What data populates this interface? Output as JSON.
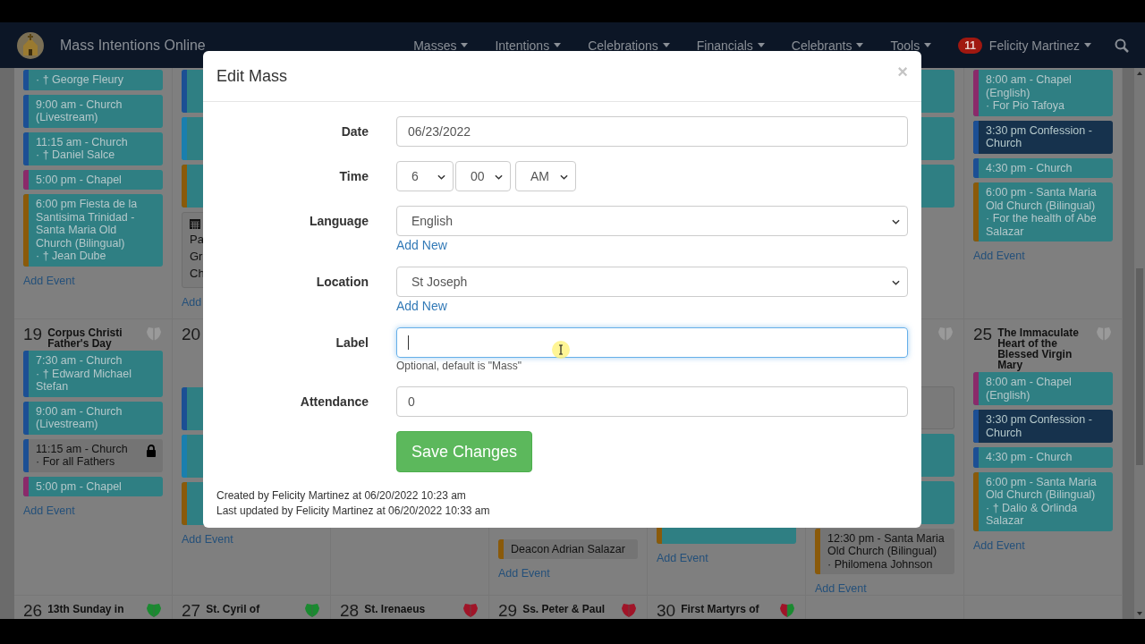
{
  "navbar": {
    "brand": "Mass Intentions Online",
    "menus": [
      "Masses",
      "Intentions",
      "Celebrations",
      "Financials",
      "Celebrants",
      "Tools"
    ],
    "notifications": "11",
    "user": "Felicity Martinez"
  },
  "calendar": {
    "columns": [
      {
        "top": {
          "events": [
            {
              "kind": "mass",
              "color": "#1c4f94",
              "intention": "· † George Fleury"
            },
            {
              "kind": "mass",
              "color": "#1c4f94",
              "title": "9:00 am - Church (Livestream)"
            },
            {
              "kind": "mass",
              "color": "#1c4f94",
              "title": "11:15 am - Church",
              "intention": "· † Daniel Salce"
            },
            {
              "kind": "mass",
              "color": "#8a2a6a",
              "title": "5:00 pm - Chapel"
            },
            {
              "kind": "mass",
              "color": "#8a5a0a",
              "title": "6:00 pm Fiesta de la Santisima Trinidad - Santa Maria Old Church (Bilingual)",
              "intention": "· † Jean Dube"
            }
          ],
          "add_event": "Add Event"
        },
        "middle": {
          "day": "19",
          "titles": [
            "Corpus Christi",
            "Father's Day"
          ],
          "vestment": [
            {
              "color": "#9a9a9a"
            }
          ],
          "events": [
            {
              "kind": "mass",
              "color": "#1c4f94",
              "title": "7:30 am - Church",
              "intention": "· † Edward Michael Stefan"
            },
            {
              "kind": "mass",
              "color": "#1c4f94",
              "title": "9:00 am - Church (Livestream)"
            },
            {
              "kind": "plain",
              "color": "#1c4f94",
              "locked": true,
              "title": "11:15 am - Church",
              "intention": "· For all Fathers"
            },
            {
              "kind": "mass",
              "color": "#8a2a6a",
              "title": "5:00 pm - Chapel"
            }
          ],
          "add_event": "Add Event"
        },
        "bottom": {
          "day": "26",
          "titles": [
            "13th Sunday in"
          ],
          "vestment": [
            {
              "color": "#1a8a30"
            }
          ]
        }
      },
      {
        "top": {
          "events": [
            {
              "kind": "mass",
              "color": "#1c4f94"
            },
            {
              "kind": "mass",
              "color": "#1a7fae"
            },
            {
              "kind": "mass",
              "color": "#8a5a0a"
            },
            {
              "kind": "note",
              "lines": [
                "Pa",
                "Gr",
                "Ch"
              ]
            }
          ],
          "add_event": "Add"
        },
        "middle": {
          "day": "20",
          "events": [
            {
              "kind": "mass",
              "color": "#1c4f94"
            },
            {
              "kind": "mass",
              "color": "#1a7fae"
            },
            {
              "kind": "mass",
              "color": "#8a5a0a"
            }
          ],
          "add_event": "Add Event"
        },
        "bottom": {
          "day": "27",
          "titles": [
            "St. Cyril of"
          ],
          "vestment": [
            {
              "color": "#1a8a30"
            }
          ]
        }
      },
      {
        "bottom": {
          "day": "28",
          "titles": [
            "St. Irenaeus"
          ],
          "vestment": [
            {
              "color": "#a01428"
            }
          ]
        }
      },
      {
        "middle": {
          "events": [
            {
              "kind": "plain",
              "color": "#8a5a0a",
              "locked": false,
              "intention": "Deacon Adrian Salazar"
            }
          ],
          "add_event": "Add Event"
        },
        "bottom": {
          "day": "29",
          "titles": [
            "Ss. Peter & Paul"
          ],
          "vestment": [
            {
              "color": "#a01428"
            }
          ]
        }
      },
      {
        "middle": {
          "events": [
            {
              "kind": "mass",
              "color": "#8a5a0a"
            }
          ],
          "add_event": "Add Event"
        },
        "bottom": {
          "day": "30",
          "titles": [
            "First Martyrs of"
          ],
          "vestment": [
            {
              "color": "#a01428"
            },
            {
              "color": "#1a8a30"
            }
          ]
        }
      },
      {
        "top": {
          "events": [
            {
              "kind": "mass"
            },
            {
              "kind": "mass"
            },
            {
              "kind": "mass"
            }
          ]
        },
        "middle": {
          "vestment": [
            {
              "color": "#9a9a9a"
            }
          ],
          "events": [
            {
              "kind": "note"
            },
            {
              "kind": "mass"
            },
            {
              "kind": "mass"
            },
            {
              "kind": "plain",
              "color": "#8a5a0a",
              "locked": false,
              "title": "12:30 pm - Santa Maria Old Church (Bilingual)",
              "intention": "· Philomena Johnson"
            }
          ],
          "add_event": "Add Event"
        }
      },
      {
        "top": {
          "events": [
            {
              "kind": "mass",
              "color": "#8a2a6a",
              "title": "8:00 am - Chapel (English)",
              "intention": "· For Pio Tafoya"
            },
            {
              "kind": "confession",
              "color": "#1c4f94",
              "title": "3:30 pm Confession - Church"
            },
            {
              "kind": "mass",
              "color": "#1c4f94",
              "title": "4:30 pm - Church"
            },
            {
              "kind": "mass",
              "color": "#8a5a0a",
              "title": "6:00 pm - Santa Maria Old Church (Bilingual)",
              "intention": "· For the health of Abe Salazar"
            }
          ],
          "add_event": "Add Event"
        },
        "middle": {
          "day": "25",
          "titles": [
            "The Immaculate Heart of the Blessed Virgin Mary"
          ],
          "vestment": [
            {
              "color": "#9a9a9a"
            }
          ],
          "events": [
            {
              "kind": "mass",
              "color": "#8a2a6a",
              "title": "8:00 am - Chapel (English)"
            },
            {
              "kind": "confession",
              "color": "#1c4f94",
              "title": "3:30 pm Confession - Church"
            },
            {
              "kind": "mass",
              "color": "#1c4f94",
              "title": "4:30 pm - Church"
            },
            {
              "kind": "mass",
              "color": "#8a5a0a",
              "title": "6:00 pm - Santa Maria Old Church (Bilingual)",
              "intention": "· † Dalio & Orlinda Salazar"
            }
          ],
          "add_event": "Add Event"
        }
      }
    ]
  },
  "modal": {
    "title": "Edit Mass",
    "close": "×",
    "fields": [
      {
        "kind": "text",
        "label": "Date",
        "value": "06/23/2022",
        "focused": false
      },
      {
        "kind": "time",
        "label": "Time",
        "values": [
          "6",
          "00",
          "AM"
        ]
      },
      {
        "kind": "select",
        "label": "Language",
        "value": "English",
        "link": "Add New"
      },
      {
        "kind": "select",
        "label": "Location",
        "value": "St Joseph",
        "link": "Add New"
      },
      {
        "kind": "text",
        "label": "Label",
        "focused": true,
        "help": "Optional, default is \"Mass\""
      },
      {
        "kind": "text",
        "label": "Attendance",
        "value": "0",
        "focused": false
      }
    ],
    "save_button": "Save Changes",
    "footer": [
      "Created by Felicity Martinez at 06/20/2022 10:23 am",
      "Last updated by Felicity Martinez at 06/20/2022 10:33 am"
    ]
  }
}
